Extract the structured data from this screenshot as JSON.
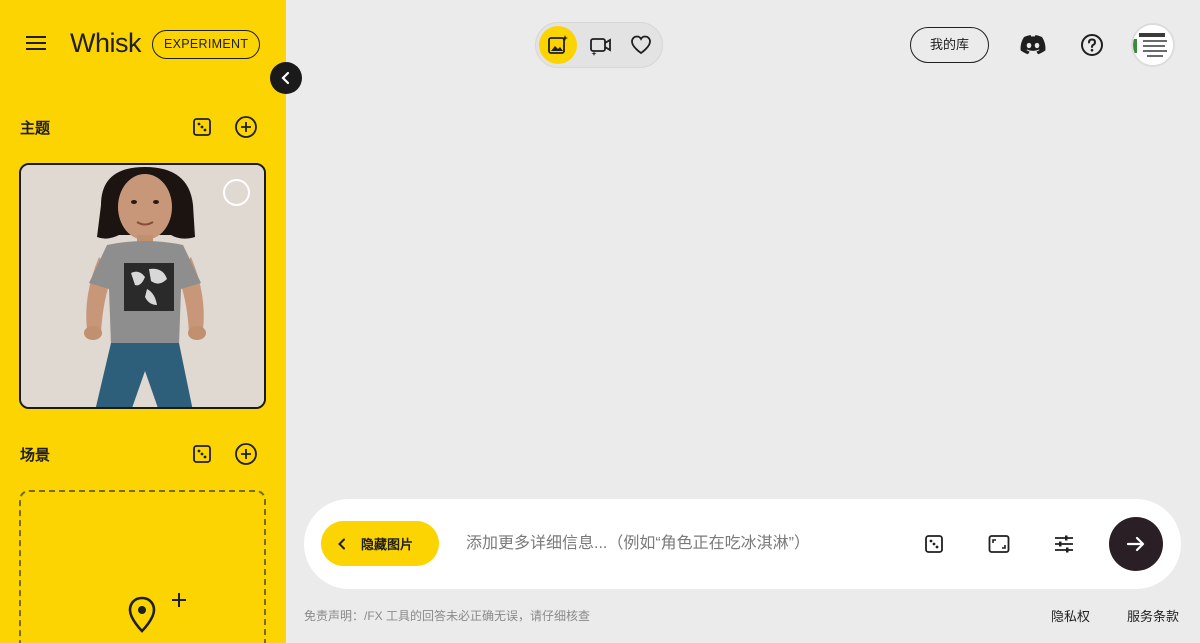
{
  "header": {
    "brand": "Whisk",
    "badge": "EXPERIMENT",
    "library_label": "我的库"
  },
  "icons": {
    "menu": "hamburger-menu-icon",
    "collapse": "chevron-left-icon",
    "dice": "dice-icon",
    "add": "add-circle-icon",
    "image_mode": "image-sparkle-icon",
    "video_mode": "video-sparkle-icon",
    "favorites": "heart-icon",
    "discord": "discord-icon",
    "help": "help-circle-icon",
    "aspect_ratio": "aspect-ratio-icon",
    "settings": "tune-icon",
    "send": "arrow-right-icon",
    "location": "location-pin-icon"
  },
  "sidebar": {
    "subject_title": "主题",
    "scene_title": "场景"
  },
  "prompt": {
    "hide_images_label": "隐藏图片",
    "placeholder": "添加更多详细信息...（例如“角色正在吃冰淇淋”）"
  },
  "footer": {
    "disclaimer": "免责声明：/FX 工具的回答未必正确无误，请仔细核查",
    "privacy": "隐私权",
    "terms": "服务条款"
  },
  "colors": {
    "accent": "#fcd402",
    "background": "#ebebeb",
    "dark": "#1f1f1f",
    "send_button": "#2a1f24"
  }
}
